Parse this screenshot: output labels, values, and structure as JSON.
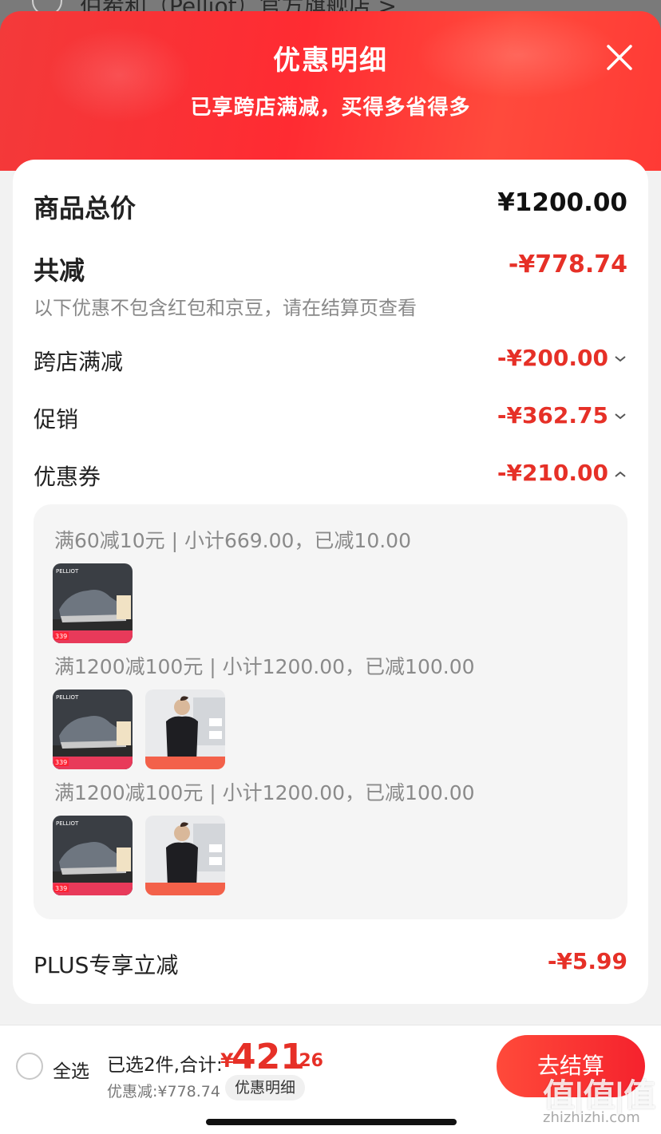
{
  "background_shop": {
    "name": "伯希和（Pelliot）官方旗舰店 >"
  },
  "header": {
    "title": "优惠明细",
    "subtitle": "已享跨店满减，买得多省得多",
    "close_icon": "close-icon",
    "gradient_colors": [
      "#f33a3a",
      "#ff2b32",
      "#ff4a3c"
    ]
  },
  "summary": {
    "total_label": "商品总价",
    "total_value": "¥1200.00",
    "reduce_label": "共减",
    "reduce_value": "-¥778.74",
    "note": "以下优惠不包含红包和京豆，请在结算页查看"
  },
  "discounts": [
    {
      "label": "跨店满减",
      "value": "-¥200.00",
      "expanded": false
    },
    {
      "label": "促销",
      "value": "-¥362.75",
      "expanded": false
    },
    {
      "label": "优惠券",
      "value": "-¥210.00",
      "expanded": true
    }
  ],
  "coupon_groups": [
    {
      "title": "满60减10元 | 小计669.00，已减10.00",
      "products": [
        "shoe"
      ]
    },
    {
      "title": "满1200减100元 | 小计1200.00，已减100.00",
      "products": [
        "shoe",
        "shirt"
      ]
    },
    {
      "title": "满1200减100元 | 小计1200.00，已减100.00",
      "products": [
        "shoe",
        "shirt"
      ]
    }
  ],
  "plus": {
    "label": "PLUS专享立减",
    "value": "-¥5.99"
  },
  "footer": {
    "select_all": "全选",
    "selected": "已选2件,合计:",
    "currency": "¥",
    "amount_int": "421",
    "amount_dec": ".26",
    "discount": "优惠减:¥778.74",
    "detail_button": "优惠明细",
    "checkout_button": "去结算"
  },
  "watermark": {
    "logo": "值|值|值",
    "url": "zhizhizhi.com"
  },
  "colors": {
    "accent": "#e63027",
    "checkout": "#f5222d"
  }
}
